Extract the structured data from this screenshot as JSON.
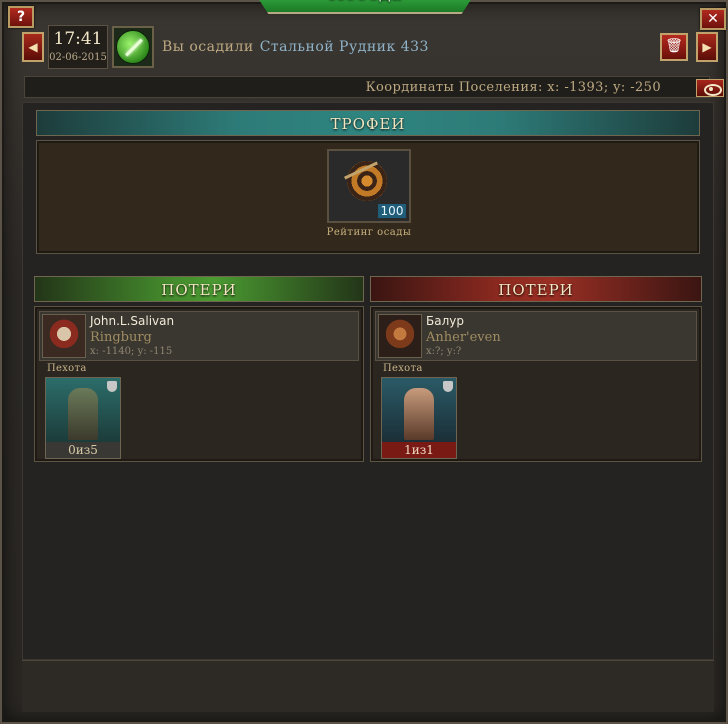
{
  "window": {
    "title": "Победа",
    "help_label": "?",
    "close_label": "✕"
  },
  "header": {
    "time": "17:41",
    "date": "02-06-2015",
    "message_prefix": "Вы осадили",
    "message_target": "Стальной Рудник 433",
    "prev_label": "◀",
    "next_label": "▶",
    "delete_label": "🗑"
  },
  "coordinates": {
    "label": "Координаты Поселения: x: -1393; y: -250"
  },
  "trophies": {
    "heading": "ТРОФЕИ",
    "item": {
      "icon": "target-arrow-icon",
      "count": "100",
      "caption": "Рейтинг осады"
    }
  },
  "losses": {
    "left": {
      "heading": "ПОТЕРИ",
      "player": {
        "name": "John.L.Salivan",
        "settlement": "Ringburg",
        "coords": "x: -1140; y: -115"
      },
      "unit_type": "Пехота",
      "unit_count": "0из5"
    },
    "right": {
      "heading": "ПОТЕРИ",
      "player": {
        "name": "Балур",
        "settlement": "Anher'even",
        "coords": "x:?; y:?"
      },
      "unit_type": "Пехота",
      "unit_count": "1из1"
    }
  },
  "colors": {
    "title_green": "#2ea43a",
    "trophy_teal": "#2f8580",
    "loss_green": "#4a9a31",
    "loss_red": "#9a2f24",
    "count_blue": "#1f5d78"
  }
}
